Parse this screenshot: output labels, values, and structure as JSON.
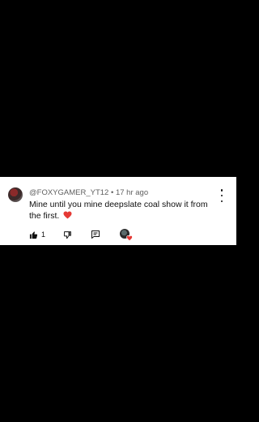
{
  "comment": {
    "username": "@FOXYGAMER_YT12",
    "separator": "•",
    "timestamp": "17 hr ago",
    "text": "Mine until you mine deepslate coal show it from the first.",
    "like_count": "1"
  },
  "colors": {
    "heart": "#e53935",
    "text": "#0f0f0f",
    "meta": "#606060"
  }
}
